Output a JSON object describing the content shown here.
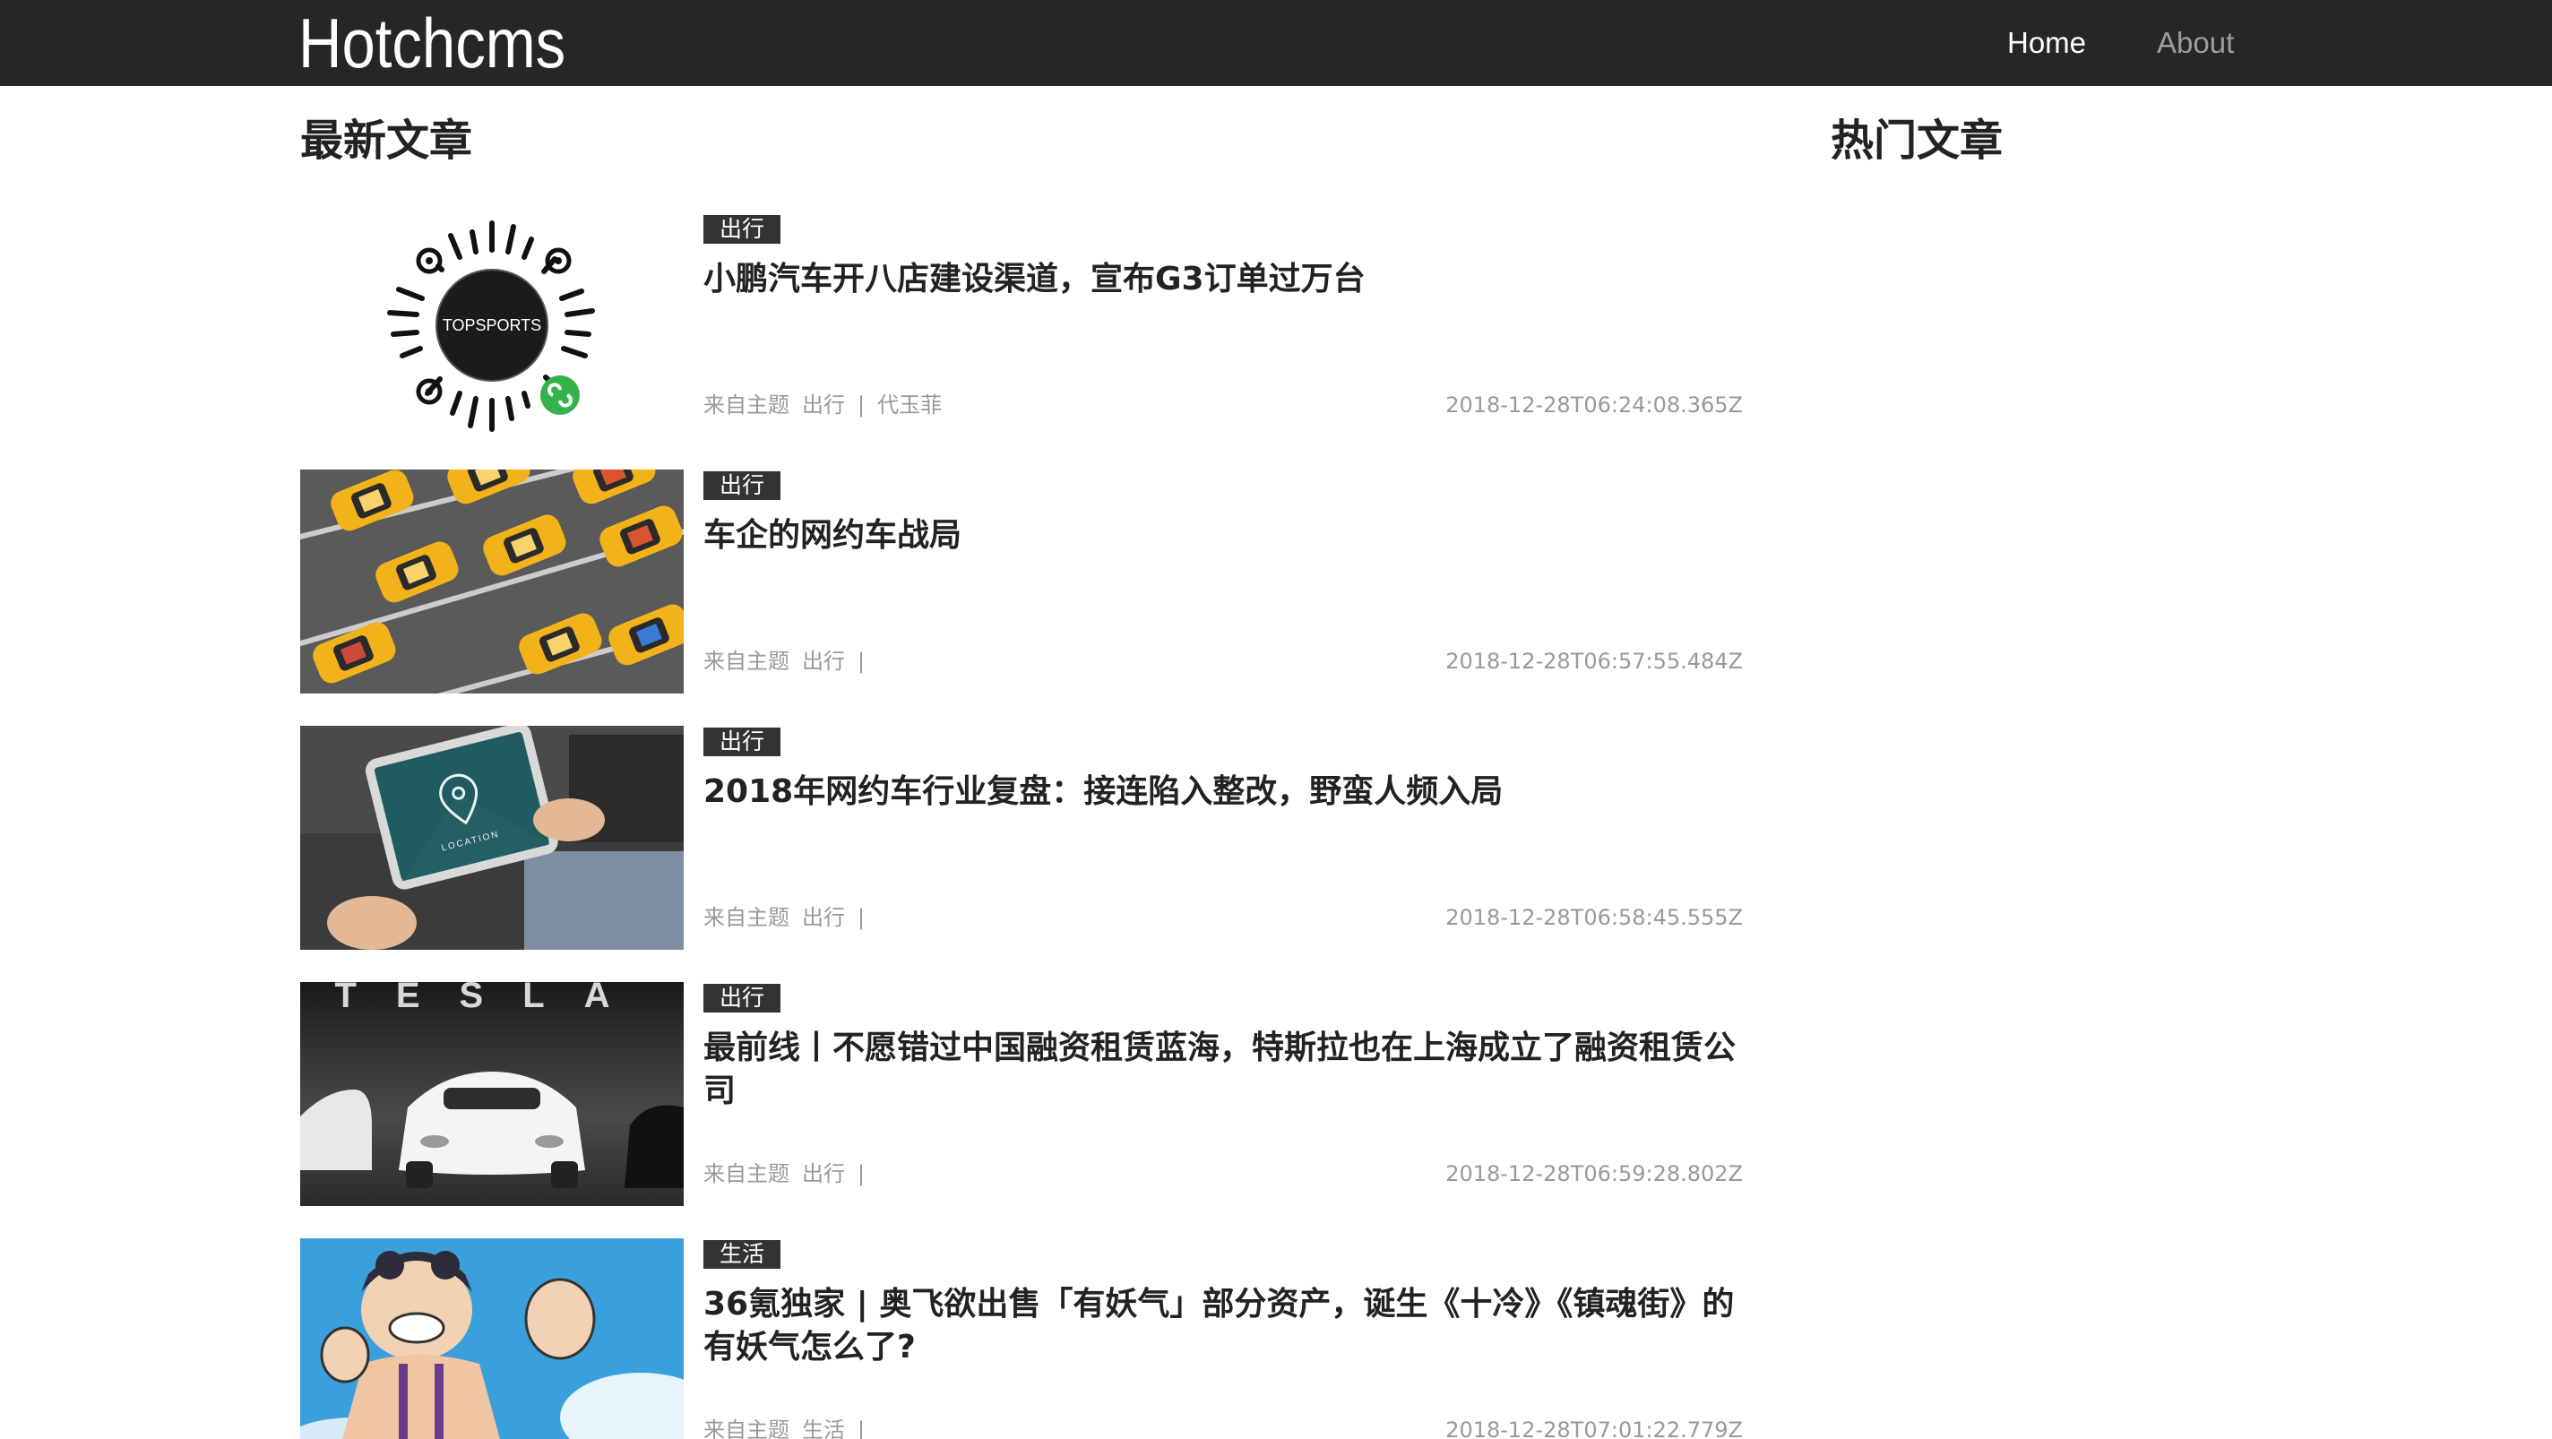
{
  "navbar": {
    "brand": "Hotchcms",
    "links": [
      {
        "label": "Home",
        "active": true
      },
      {
        "label": "About",
        "active": false
      }
    ]
  },
  "sections": {
    "latest": "最新文章",
    "hot": "热门文章"
  },
  "articles": [
    {
      "thumbnail": "qr-code-topsports",
      "thumbnail_text": "TOPSPORTS",
      "tag": "出行",
      "title": "小鹏汽车开八店建设渠道，宣布G3订单过万台",
      "source": "来自主题",
      "category": "出行",
      "separator": "|",
      "author": "代玉菲",
      "time": "2018-12-28T06:24:08.365Z"
    },
    {
      "thumbnail": "yellow-taxis-photo",
      "tag": "出行",
      "title": "车企的网约车战局",
      "source": "来自主题",
      "category": "出行",
      "separator": "|",
      "author": "",
      "time": "2018-12-28T06:57:55.484Z"
    },
    {
      "thumbnail": "tablet-location-photo",
      "thumbnail_text": "LOCATION",
      "tag": "出行",
      "title": "2018年网约车行业复盘：接连陷入整改，野蛮人频入局",
      "source": "来自主题",
      "category": "出行",
      "separator": "|",
      "author": "",
      "time": "2018-12-28T06:58:45.555Z"
    },
    {
      "thumbnail": "tesla-cars-photo",
      "thumbnail_text": "TESLA",
      "tag": "出行",
      "title": "最前线丨不愿错过中国融资租赁蓝海，特斯拉也在上海成立了融资租赁公司",
      "source": "来自主题",
      "category": "出行",
      "separator": "|",
      "author": "",
      "time": "2018-12-28T06:59:28.802Z"
    },
    {
      "thumbnail": "anime-character-illustration",
      "tag": "生活",
      "title": "36氪独家 | 奥飞欲出售「有妖气」部分资产，诞生《十冷》《镇魂街》的有妖气怎么了?",
      "source": "来自主题",
      "category": "生活",
      "separator": "|",
      "author": "",
      "time": "2018-12-28T07:01:22.779Z"
    }
  ],
  "colors": {
    "navbar_bg": "#262626",
    "nav_active": "#ffffff",
    "nav_inactive": "#9d9d9d",
    "tag_bg": "#333333",
    "meta_text": "#999999"
  }
}
